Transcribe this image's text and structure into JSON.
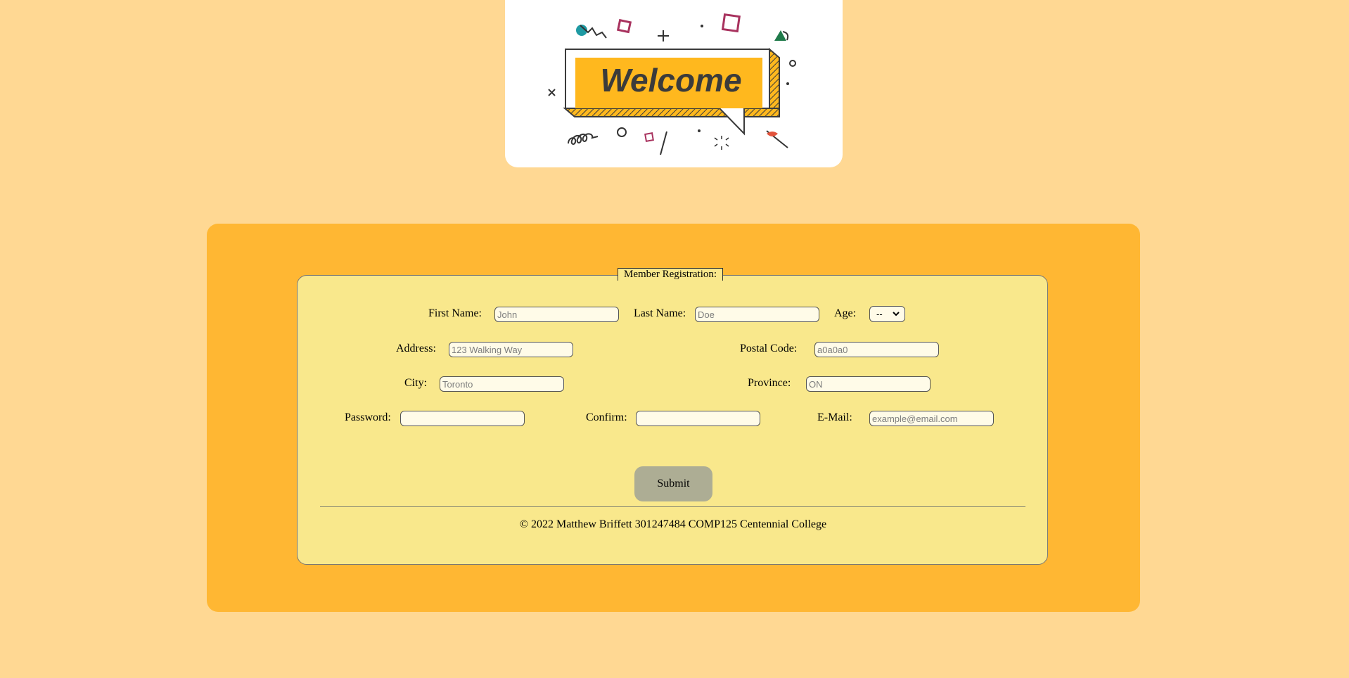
{
  "banner": {
    "text": "Welcome",
    "accent_color": "#ffb81e",
    "ink_color": "#3b3b3b"
  },
  "form": {
    "legend": "Member Registration:",
    "fields": {
      "first_name": {
        "label": "First Name:",
        "placeholder": "John"
      },
      "last_name": {
        "label": "Last Name:",
        "placeholder": "Doe"
      },
      "age": {
        "label": "Age:",
        "selected": "--"
      },
      "address": {
        "label": "Address:",
        "placeholder": "123 Walking Way"
      },
      "postal_code": {
        "label": "Postal Code:",
        "placeholder": "a0a0a0"
      },
      "city": {
        "label": "City:",
        "placeholder": "Toronto"
      },
      "province": {
        "label": "Province:",
        "placeholder": "ON"
      },
      "password": {
        "label": "Password:",
        "placeholder": ""
      },
      "confirm": {
        "label": "Confirm:",
        "placeholder": ""
      },
      "email": {
        "label": "E-Mail:",
        "placeholder": "example@email.com"
      }
    },
    "submit_label": "Submit"
  },
  "footer": {
    "text": "© 2022 Matthew Briffett 301247484 COMP125 Centennial College"
  },
  "colors": {
    "page_background": "#ffd893",
    "panel_background": "#ffb733",
    "form_background": "#f9e88c",
    "submit_background": "#adad94"
  }
}
